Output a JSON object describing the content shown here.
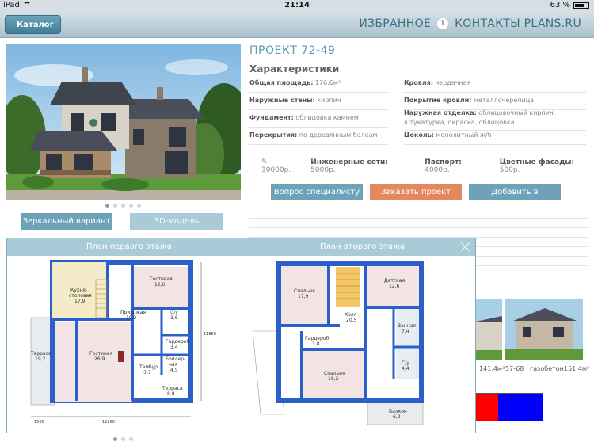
{
  "status": {
    "carrier": "iPad",
    "time": "21:14",
    "battery": "63 %"
  },
  "nav": {
    "back_label": "Каталог",
    "favorites_label": "ИЗБРАННОЕ",
    "favorites_count": "1",
    "contacts_label": "КОНТАКТЫ PLANS.RU"
  },
  "project": {
    "title": "ПРОЕКТ 72-49",
    "subtitle": "Характеристики",
    "specs": [
      {
        "label": "Общая площадь:",
        "value": "176.6м²"
      },
      {
        "label": "Кровля:",
        "value": "чердачная"
      },
      {
        "label": "Наружные стены:",
        "value": "кирпич"
      },
      {
        "label": "Покрытие кровли:",
        "value": "металлочерепица"
      },
      {
        "label": "Фундамент:",
        "value": "облицовка камнем"
      },
      {
        "label": "Наружная отделка:",
        "value": "облицовочный кирпич, штукатурка, окраска, облицовка"
      },
      {
        "label": "Перекрытия:",
        "value": "по деревянным балкам"
      },
      {
        "label": "Цоколь:",
        "value": "монолитный ж/б"
      }
    ],
    "prices": [
      {
        "label": "",
        "value": "30000р."
      },
      {
        "label": "Инженерные сети:",
        "value": "5000р."
      },
      {
        "label": "Паспорт:",
        "value": "4000р."
      },
      {
        "label": "Цветные фасады:",
        "value": "500р."
      }
    ]
  },
  "buttons": {
    "mirror": "Зеркальный вариант",
    "model3d": "3D-модель",
    "ask": "Вопрос специалисту",
    "order": "Заказать проект",
    "add_fav": "Добавить в избранное"
  },
  "overlay": {
    "title_first": "План первого этажа",
    "title_second": "План второго этажа",
    "first_floor": {
      "rooms": [
        {
          "name": "Кухня-",
          "name2": "столовая",
          "area": "17,9"
        },
        {
          "name": "Гостевая",
          "area": "12,6"
        },
        {
          "name": "Прихожая",
          "area": "19,2"
        },
        {
          "name": "С/у",
          "area": "3,6"
        },
        {
          "name": "Гардероб",
          "area": "3,4"
        },
        {
          "name": "Терраса",
          "area": "19,2"
        },
        {
          "name": "Гостиная",
          "area": "26,9"
        },
        {
          "name": "Бойлер-",
          "name2": "ная",
          "area": "4,5"
        },
        {
          "name": "Тамбур",
          "area": "3,7"
        },
        {
          "name": "Терраса",
          "area": "8,8"
        }
      ],
      "dims": [
        "1500",
        "12260",
        "11860"
      ]
    },
    "second_floor": {
      "rooms": [
        {
          "name": "Спальня",
          "area": "17,9"
        },
        {
          "name": "Детская",
          "area": "12,6"
        },
        {
          "name": "Холл",
          "area": "20,5"
        },
        {
          "name": "Ванная",
          "area": "7,4"
        },
        {
          "name": "Гардероб",
          "area": "3,8"
        },
        {
          "name": "С/у",
          "area": "4,4"
        },
        {
          "name": "Спальня",
          "area": "18,2"
        },
        {
          "name": "Балкон",
          "area": "6,9"
        }
      ]
    }
  },
  "thumbs": [
    {
      "area": "141.4м²"
    },
    {
      "code": "57-68",
      "material": "газобетон",
      "area": "151.4м²"
    }
  ],
  "colors": {
    "accent": "#5b9bb6",
    "order": "#e4885e",
    "plan_wall": "#2b5fc9",
    "swatch_red": "#ff0000",
    "swatch_blue": "#0000ff"
  }
}
